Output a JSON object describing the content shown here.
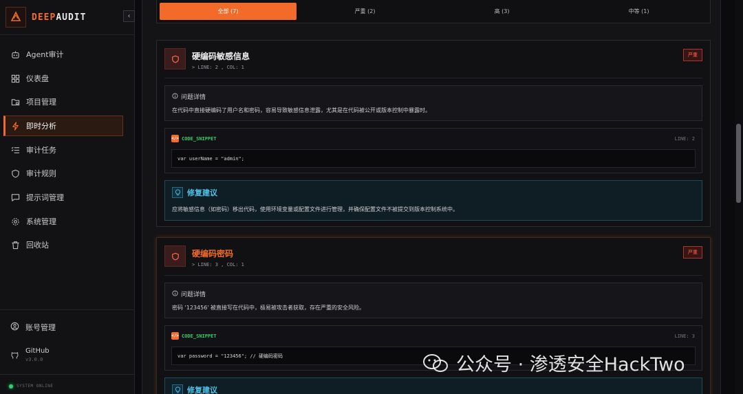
{
  "brand": {
    "part1": "DEEP",
    "part2": "AUDIT",
    "collapse": "‹"
  },
  "sidebar": {
    "items": [
      {
        "label": "Agent审计",
        "icon": "bot-icon",
        "active": false
      },
      {
        "label": "仪表盘",
        "icon": "dashboard-icon",
        "active": false
      },
      {
        "label": "项目管理",
        "icon": "folder-icon",
        "active": false
      },
      {
        "label": "即时分析",
        "icon": "bolt-icon",
        "active": true
      },
      {
        "label": "审计任务",
        "icon": "task-list-icon",
        "active": false
      },
      {
        "label": "审计规则",
        "icon": "shield-icon",
        "active": false
      },
      {
        "label": "提示词管理",
        "icon": "chat-icon",
        "active": false
      },
      {
        "label": "系统管理",
        "icon": "gear-icon",
        "active": false
      },
      {
        "label": "回收站",
        "icon": "trash-icon",
        "active": false
      }
    ],
    "account": "账号管理",
    "github": {
      "title": "GitHub",
      "version": "v3.0.0"
    },
    "status": "SYSTEM ONLINE"
  },
  "filters": [
    {
      "label": "全部 (7)",
      "active": true
    },
    {
      "label": "严重 (2)",
      "active": false
    },
    {
      "label": "高 (3)",
      "active": false
    },
    {
      "label": "中等 (1)",
      "active": false
    }
  ],
  "issues": [
    {
      "title": "硬编码敏感信息",
      "location": "LINE: 2 , COL: 1",
      "severity": "严重",
      "detail_label": "问题详情",
      "detail": "在代码中直接硬编码了用户名和密码，容易导致敏感信息泄露，尤其是在代码被公开或版本控制中暴露时。",
      "code_label": "CODE_SNIPPET",
      "code_line": "LINE: 2",
      "code": "var userName = \"admin\";",
      "fix_label": "修复建议",
      "fix": "应将敏感信息（如密码）移出代码，使用环境变量或配置文件进行管理，并确保配置文件不被提交到版本控制系统中。"
    },
    {
      "title": "硬编码密码",
      "location": "LINE: 3 , COL: 1",
      "severity": "严重",
      "detail_label": "问题详情",
      "detail": "密码 '123456' 被直接写在代码中，极易被攻击者获取，存在严重的安全风险。",
      "code_label": "CODE_SNIPPET",
      "code_line": "LINE: 3",
      "code": "var password = \"123456\"; // 硬编码密码",
      "fix_label": "修复建议"
    }
  ],
  "watermark": "公众号 · 渗透安全HackTwo"
}
